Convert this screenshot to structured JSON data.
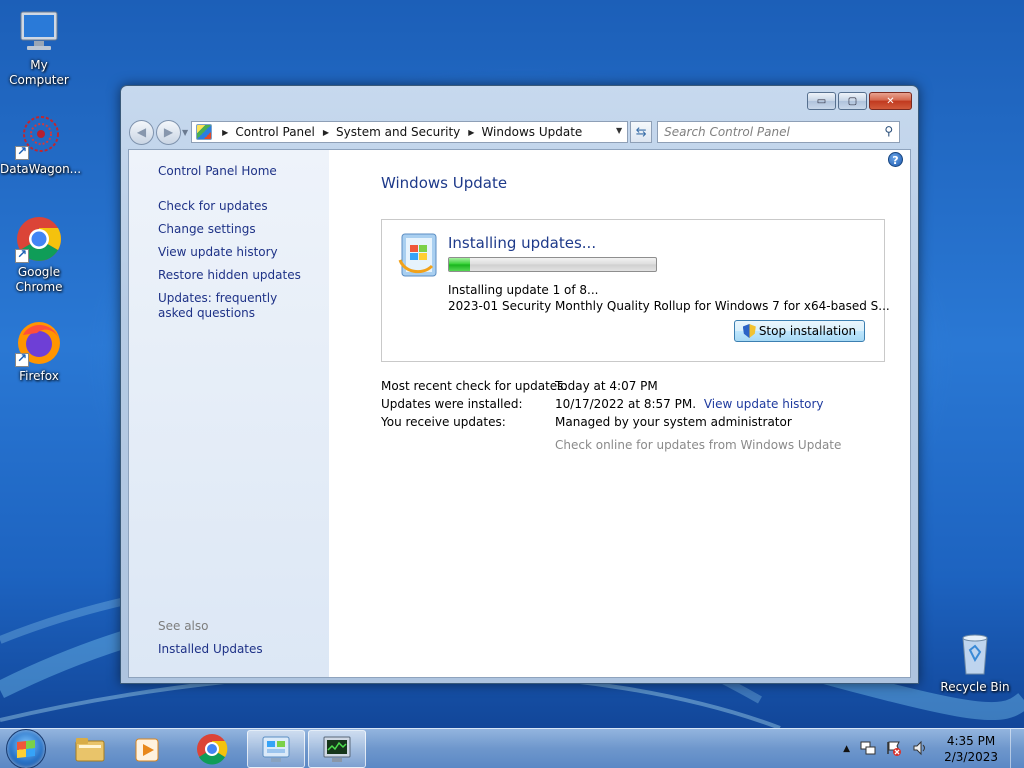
{
  "desktop": {
    "icons": [
      {
        "label": "My Computer",
        "icon": "computer-icon"
      },
      {
        "label": "DataWagon...",
        "icon": "datawagon-icon"
      },
      {
        "label": "Google Chrome",
        "icon": "chrome-icon"
      },
      {
        "label": "Firefox",
        "icon": "firefox-icon"
      },
      {
        "label": "Recycle Bin",
        "icon": "recycle-bin-icon"
      }
    ]
  },
  "window": {
    "caption": {
      "minimize": "▭",
      "maximize": "▢",
      "close": "✕"
    },
    "breadcrumbs": [
      "Control Panel",
      "System and Security",
      "Windows Update"
    ],
    "search": {
      "placeholder": "Search Control Panel"
    },
    "left_nav": {
      "home": "Control Panel Home",
      "items": [
        "Check for updates",
        "Change settings",
        "View update history",
        "Restore hidden updates",
        "Updates: frequently asked questions"
      ],
      "see_also_label": "See also",
      "see_also_items": [
        "Installed Updates"
      ]
    },
    "main": {
      "title": "Windows Update",
      "status": {
        "heading": "Installing updates...",
        "progress": 0.1,
        "line1": "Installing update 1 of 8...",
        "line2": "2023-01 Security Monthly Quality Rollup for Windows 7 for x64-based S...",
        "stop_button": "Stop installation"
      },
      "info": {
        "recent_check_label": "Most recent check for updates:",
        "recent_check_value": "Today at 4:07 PM",
        "installed_label": "Updates were installed:",
        "installed_value": "10/17/2022 at 8:57 PM.",
        "installed_link": "View update history",
        "receive_label": "You receive updates:",
        "receive_value": "Managed by your system administrator",
        "check_online": "Check online for updates from Windows Update"
      }
    }
  },
  "taskbar": {
    "clock_time": "4:35 PM",
    "clock_date": "2/3/2023",
    "tray_expand": "▲"
  },
  "colors": {
    "link": "#1e3287",
    "title": "#1e3a8a",
    "progress": "#2fcf30"
  }
}
